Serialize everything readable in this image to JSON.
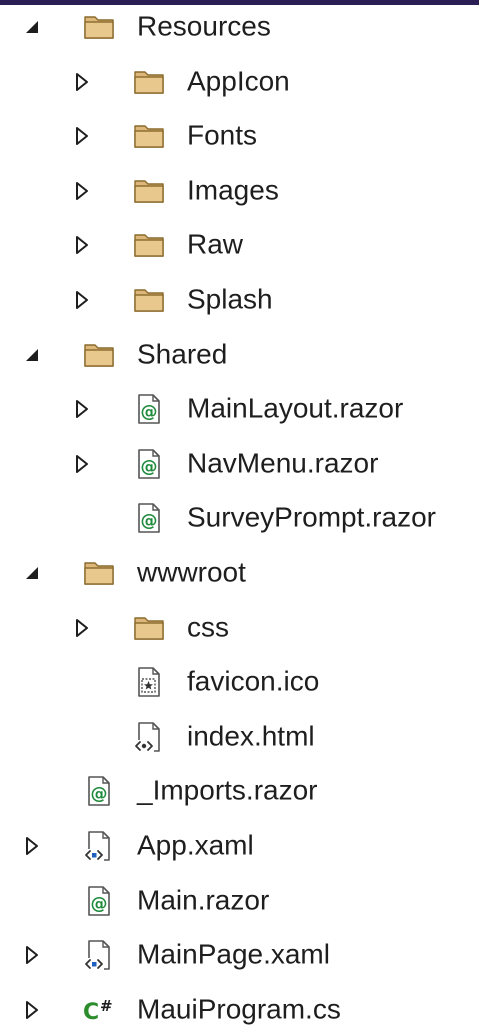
{
  "tree": {
    "items": [
      {
        "label": "Resources",
        "depth": 1,
        "expander": "expanded",
        "icon": "folder-icon"
      },
      {
        "label": "AppIcon",
        "depth": 2,
        "expander": "collapsed",
        "icon": "folder-icon"
      },
      {
        "label": "Fonts",
        "depth": 2,
        "expander": "collapsed",
        "icon": "folder-icon"
      },
      {
        "label": "Images",
        "depth": 2,
        "expander": "collapsed",
        "icon": "folder-icon"
      },
      {
        "label": "Raw",
        "depth": 2,
        "expander": "collapsed",
        "icon": "folder-icon"
      },
      {
        "label": "Splash",
        "depth": 2,
        "expander": "collapsed",
        "icon": "folder-icon"
      },
      {
        "label": "Shared",
        "depth": 1,
        "expander": "expanded",
        "icon": "folder-icon"
      },
      {
        "label": "MainLayout.razor",
        "depth": 2,
        "expander": "collapsed",
        "icon": "razor-file-icon"
      },
      {
        "label": "NavMenu.razor",
        "depth": 2,
        "expander": "collapsed",
        "icon": "razor-file-icon"
      },
      {
        "label": "SurveyPrompt.razor",
        "depth": 2,
        "expander": "none",
        "icon": "razor-file-icon"
      },
      {
        "label": "wwwroot",
        "depth": 1,
        "expander": "expanded",
        "icon": "folder-icon"
      },
      {
        "label": "css",
        "depth": 2,
        "expander": "collapsed",
        "icon": "folder-icon"
      },
      {
        "label": "favicon.ico",
        "depth": 2,
        "expander": "none",
        "icon": "ico-file-icon"
      },
      {
        "label": "index.html",
        "depth": 2,
        "expander": "none",
        "icon": "html-file-icon"
      },
      {
        "label": "_Imports.razor",
        "depth": 1,
        "expander": "none",
        "icon": "razor-file-icon"
      },
      {
        "label": "App.xaml",
        "depth": 1,
        "expander": "collapsed",
        "icon": "xaml-file-icon"
      },
      {
        "label": "Main.razor",
        "depth": 1,
        "expander": "none",
        "icon": "razor-file-icon"
      },
      {
        "label": "MainPage.xaml",
        "depth": 1,
        "expander": "collapsed",
        "icon": "xaml-file-icon"
      },
      {
        "label": "MauiProgram.cs",
        "depth": 1,
        "expander": "collapsed",
        "icon": "csharp-file-icon"
      }
    ]
  },
  "colors": {
    "folder_fill": "#dcb67a",
    "folder_stroke": "#8a6a2c",
    "razor_green": "#1f8a3b",
    "xaml_blue": "#1f5fbf",
    "csharp_green": "#2a8c2a",
    "text": "#1e1e1e",
    "top_bar": "#2b1e55"
  }
}
